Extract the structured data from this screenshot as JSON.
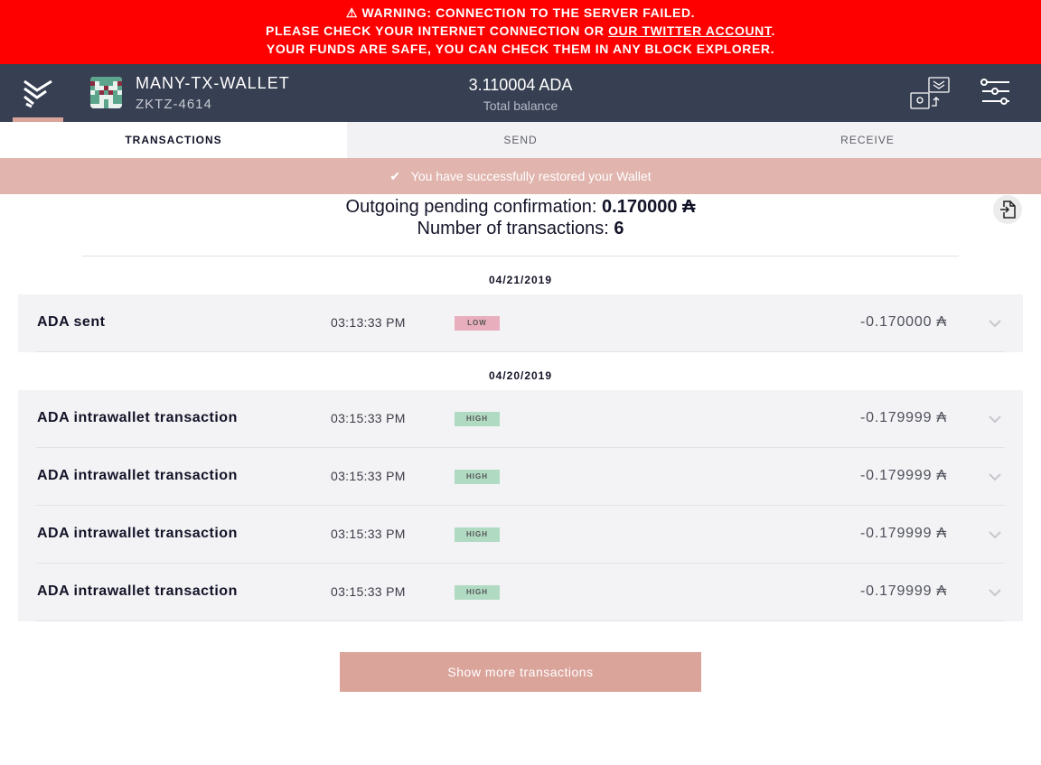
{
  "warning": {
    "line1": "WARNING: CONNECTION TO THE SERVER FAILED.",
    "line2_pre": "PLEASE CHECK YOUR INTERNET CONNECTION OR ",
    "line2_link": "OUR TWITTER ACCOUNT",
    "line2_post": ".",
    "line3": "YOUR FUNDS ARE SAFE, YOU CAN CHECK THEM IN ANY BLOCK EXPLORER.",
    "icon": "warning-triangle-icon"
  },
  "header": {
    "wallet_name": "MANY-TX-WALLET",
    "wallet_plate": "ZKTZ-4614",
    "balance": "3.110004 ADA",
    "balance_label": "Total balance"
  },
  "tabs": [
    {
      "label": "TRANSACTIONS",
      "active": true
    },
    {
      "label": "SEND"
    },
    {
      "label": "RECEIVE"
    }
  ],
  "notice": "You have successfully restored your Wallet",
  "summary": {
    "pending_label": "Outgoing pending confirmation: ",
    "pending_value": "0.170000 ₳",
    "count_label": "Number of transactions: ",
    "count_value": "6"
  },
  "groups": [
    {
      "date": "04/21/2019",
      "items": [
        {
          "title": "ADA sent",
          "time": "03:13:33 PM",
          "level": "LOW",
          "amount": "-0.170000 ₳"
        }
      ]
    },
    {
      "date": "04/20/2019",
      "items": [
        {
          "title": "ADA intrawallet transaction",
          "time": "03:15:33 PM",
          "level": "HIGH",
          "amount": "-0.179999 ₳"
        },
        {
          "title": "ADA intrawallet transaction",
          "time": "03:15:33 PM",
          "level": "HIGH",
          "amount": "-0.179999 ₳"
        },
        {
          "title": "ADA intrawallet transaction",
          "time": "03:15:33 PM",
          "level": "HIGH",
          "amount": "-0.179999 ₳"
        },
        {
          "title": "ADA intrawallet transaction",
          "time": "03:15:33 PM",
          "level": "HIGH",
          "amount": "-0.179999 ₳"
        }
      ]
    }
  ],
  "show_more": "Show more transactions",
  "colors": {
    "warning": "#ff0000",
    "header": "#373f52",
    "accent": "#daa49a",
    "low": "#e9aebd",
    "high": "#b1dac3"
  }
}
